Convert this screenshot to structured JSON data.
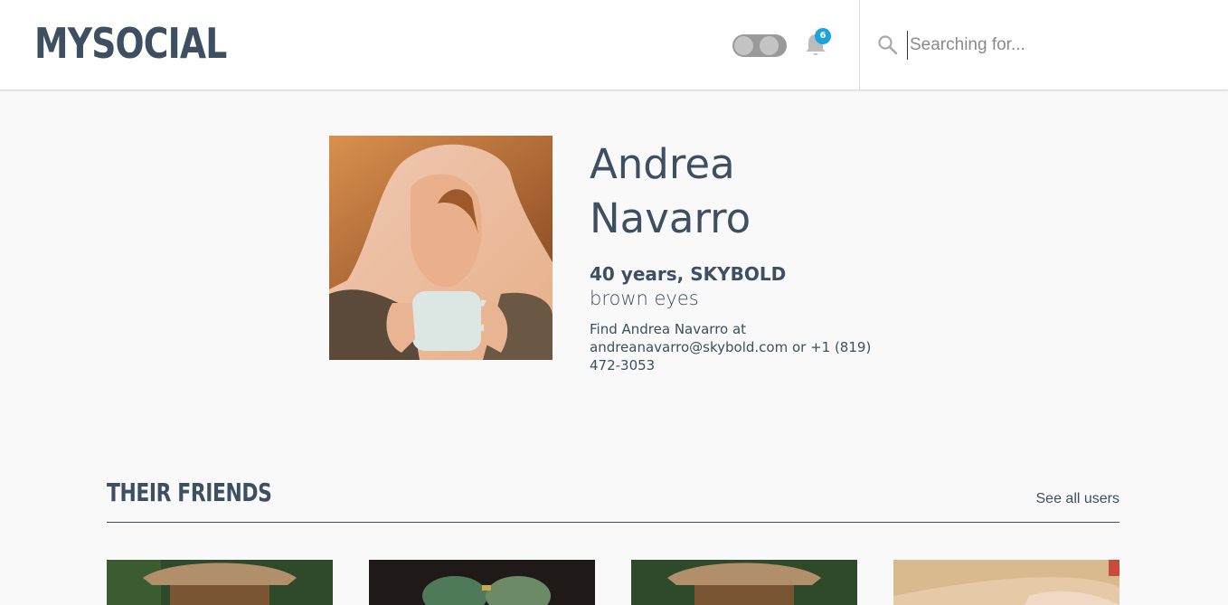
{
  "header": {
    "logo": "MYSOCIAL",
    "notifications_count": "6",
    "search_placeholder": "Searching for..."
  },
  "profile": {
    "name": "Andrea Navarro",
    "age_company": "40 years, SKYBOLD",
    "eyes": "brown eyes",
    "contact": "Find Andrea Navarro at andreanavarro@skybold.com or +1 (819) 472-3053"
  },
  "friends": {
    "title": "THEIR FRIENDS",
    "see_all": "See all users",
    "items": [
      {
        "photo": "friend-photo-1"
      },
      {
        "photo": "friend-photo-2"
      },
      {
        "photo": "friend-photo-3"
      },
      {
        "photo": "friend-photo-4"
      }
    ]
  },
  "colors": {
    "primary": "#3d4f60",
    "badge": "#1ba3dd",
    "background": "#f9f9f9"
  },
  "icons": {
    "toggle": "toggle-icon",
    "bell": "bell-icon",
    "search": "search-icon"
  }
}
